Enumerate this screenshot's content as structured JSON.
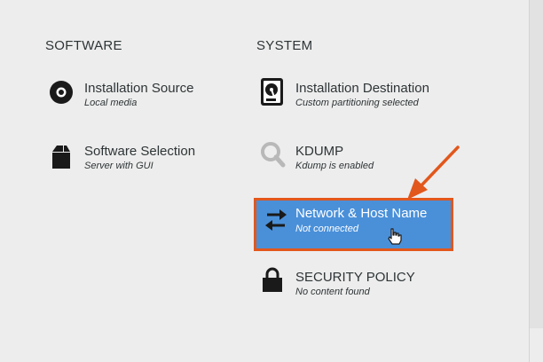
{
  "software": {
    "heading": "SOFTWARE",
    "items": [
      {
        "title": "Installation Source",
        "status": "Local media",
        "icon": "disc-icon"
      },
      {
        "title": "Software Selection",
        "status": "Server with GUI",
        "icon": "package-icon"
      }
    ]
  },
  "system": {
    "heading": "SYSTEM",
    "items": [
      {
        "title": "Installation Destination",
        "status": "Custom partitioning selected",
        "icon": "harddisk-icon"
      },
      {
        "title": "KDUMP",
        "status": "Kdump is enabled",
        "icon": "magnifier-icon"
      },
      {
        "title": "Network & Host Name",
        "status": "Not connected",
        "icon": "network-arrows-icon",
        "selected": true
      },
      {
        "title": "SECURITY POLICY",
        "status": "No content found",
        "icon": "lock-icon"
      }
    ]
  },
  "colors": {
    "selected_bg": "#4a90d9",
    "highlight_border": "#e2571c",
    "text": "#2e3436"
  }
}
